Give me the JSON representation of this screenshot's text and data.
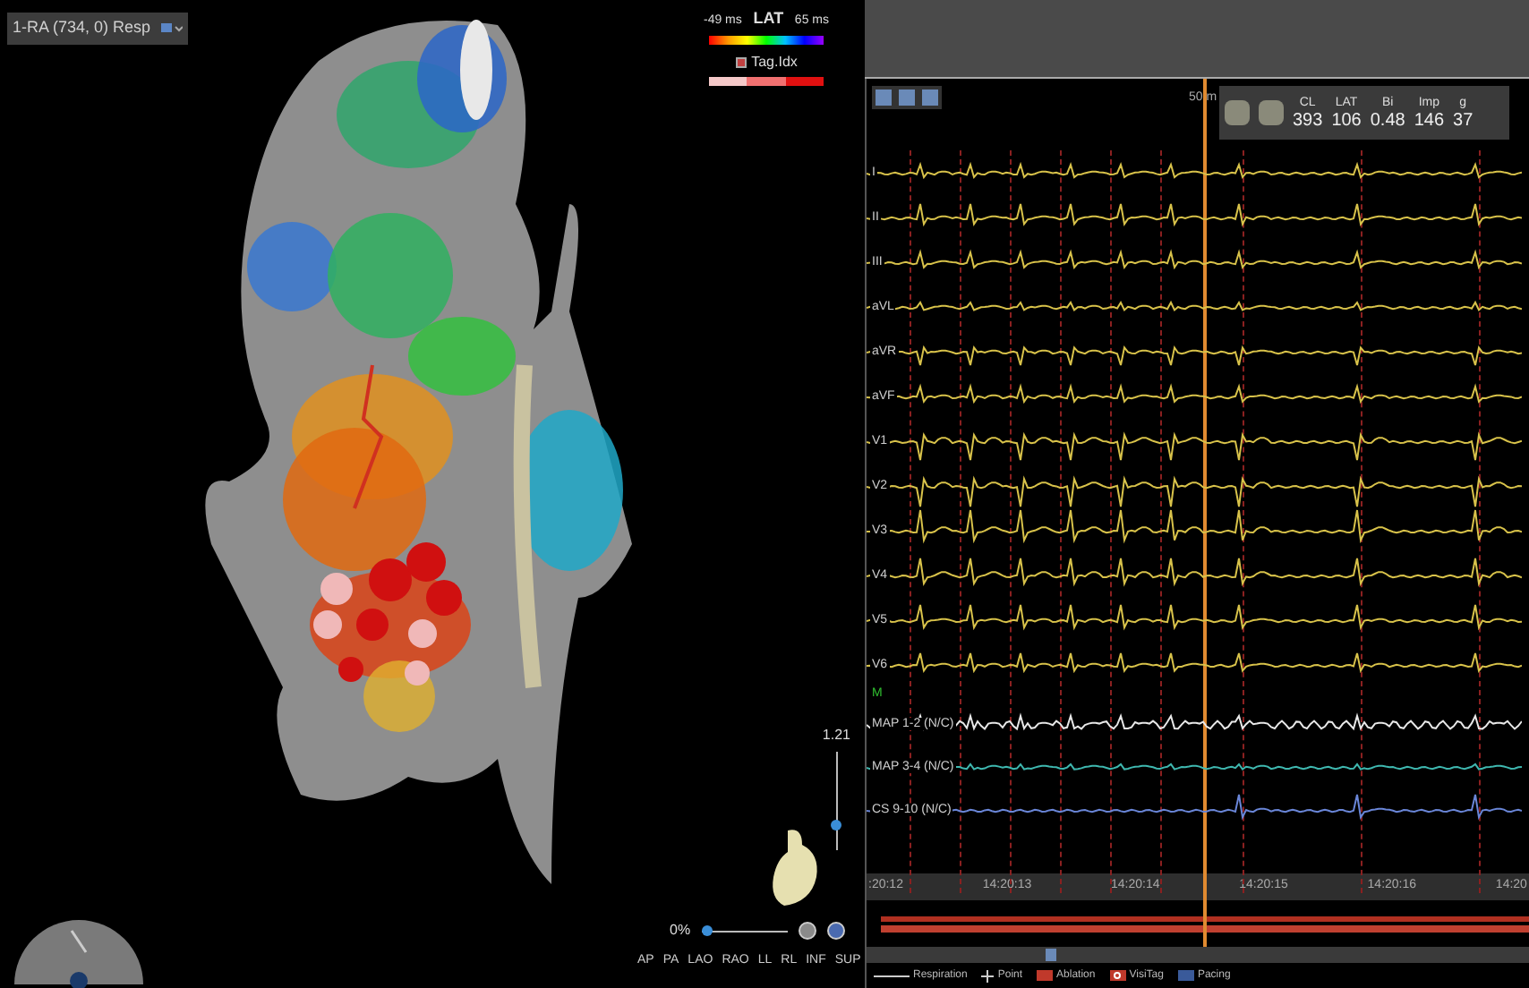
{
  "map_view": {
    "map_label": "1-RA (734, 0) Resp",
    "lat_scale": {
      "min": "-49 ms",
      "title": "LAT",
      "max": "65 ms"
    },
    "tag_index": {
      "label": "Tag.Idx",
      "checked": true
    },
    "zoom": {
      "value": "1.21",
      "level": 0.25
    },
    "transparency": {
      "value": "0%",
      "level": 0
    },
    "view_buttons": [
      "AP",
      "PA",
      "LAO",
      "RAO",
      "LL",
      "RL",
      "INF",
      "SUP"
    ]
  },
  "signals": {
    "scale_label": "50 m",
    "readings": [
      {
        "label": "CL",
        "value": "393"
      },
      {
        "label": "LAT",
        "value": "106"
      },
      {
        "label": "Bi",
        "value": "0.48"
      },
      {
        "label": "Imp",
        "value": "146"
      },
      {
        "label": "g",
        "value": "37"
      }
    ],
    "channels": [
      {
        "name": "I",
        "color": "#d8c24a"
      },
      {
        "name": "II",
        "color": "#d8c24a"
      },
      {
        "name": "III",
        "color": "#d8c24a"
      },
      {
        "name": "aVL",
        "color": "#d8c24a"
      },
      {
        "name": "aVR",
        "color": "#d8c24a"
      },
      {
        "name": "aVF",
        "color": "#d8c24a"
      },
      {
        "name": "V1",
        "color": "#d8c24a"
      },
      {
        "name": "V2",
        "color": "#d8c24a"
      },
      {
        "name": "V3",
        "color": "#d8c24a"
      },
      {
        "name": "V4",
        "color": "#d8c24a"
      },
      {
        "name": "V5",
        "color": "#d8c24a"
      },
      {
        "name": "V6",
        "color": "#d8c24a"
      }
    ],
    "marker": "M",
    "intracardiac": [
      {
        "name": "MAP 1-2 (N/C)",
        "color": "#e8e8e8"
      },
      {
        "name": "MAP 3-4 (N/C)",
        "color": "#3fb8b0"
      },
      {
        "name": "CS 9-10 (N/C)",
        "color": "#6a86d8"
      }
    ],
    "time_labels": [
      ":20:12",
      "14:20:13",
      "14:20:14",
      "14:20:15",
      "14:20:16",
      "14:20"
    ],
    "legend": [
      {
        "kind": "line",
        "label": "Respiration"
      },
      {
        "kind": "plus",
        "label": "Point"
      },
      {
        "kind": "swatch",
        "label": "Ablation",
        "color": "#c0392b"
      },
      {
        "kind": "ring",
        "label": "VisiTag",
        "color": "#c0392b"
      },
      {
        "kind": "swatch",
        "label": "Pacing",
        "color": "#3a5a9a"
      }
    ]
  }
}
